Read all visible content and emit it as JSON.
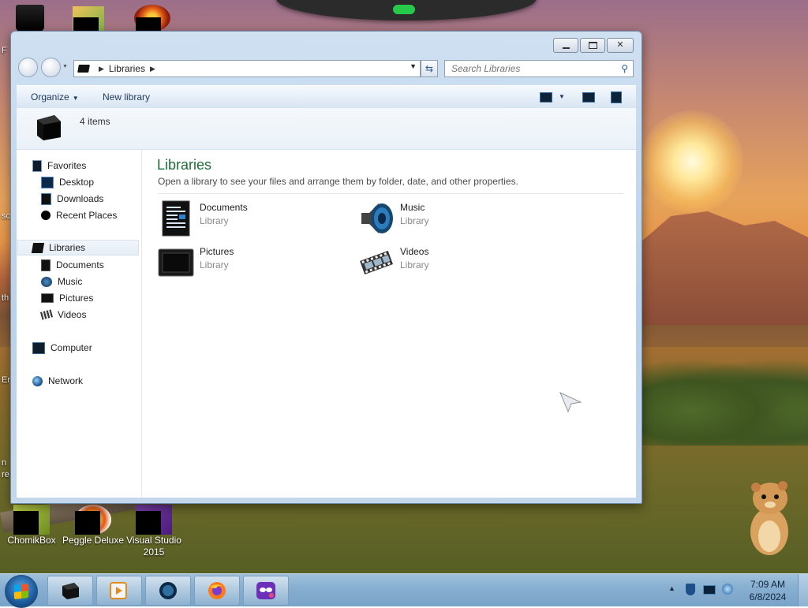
{
  "desktop": {
    "icons": [
      {
        "label": "ChomikBox"
      },
      {
        "label": "Peggle Deluxe"
      },
      {
        "label": "Visual Studio 2015"
      }
    ],
    "edge_fragments": [
      "F",
      "sc",
      "th",
      "Er",
      "n re"
    ]
  },
  "window": {
    "address": {
      "crumb": "Libraries"
    },
    "search": {
      "placeholder": "Search Libraries"
    },
    "toolbar": {
      "organize": "Organize",
      "new_library": "New library"
    },
    "details": {
      "count": "4 items"
    },
    "nav": {
      "favorites": "Favorites",
      "desktop": "Desktop",
      "downloads": "Downloads",
      "recent": "Recent Places",
      "libraries": "Libraries",
      "documents": "Documents",
      "music": "Music",
      "pictures": "Pictures",
      "videos": "Videos",
      "computer": "Computer",
      "network": "Network"
    },
    "content": {
      "title": "Libraries",
      "description": "Open a library to see your files and arrange them by folder, date, and other properties.",
      "libraries": [
        {
          "name": "Documents",
          "type": "Library",
          "icon": "documents-icon"
        },
        {
          "name": "Music",
          "type": "Library",
          "icon": "music-icon"
        },
        {
          "name": "Pictures",
          "type": "Library",
          "icon": "pictures-icon"
        },
        {
          "name": "Videos",
          "type": "Library",
          "icon": "videos-icon"
        }
      ]
    }
  },
  "taskbar": {
    "apps": [
      "explorer",
      "media-player",
      "globe-app",
      "firefox",
      "mask-app"
    ],
    "clock": {
      "time": "7:09 AM",
      "date": "6/8/2024"
    },
    "tray_icons": [
      "show-hidden-icons",
      "shield-icon",
      "monitor-icon",
      "network-icon"
    ]
  },
  "colors": {
    "content_title": "#1e6d36",
    "accent": "#1e395b"
  }
}
